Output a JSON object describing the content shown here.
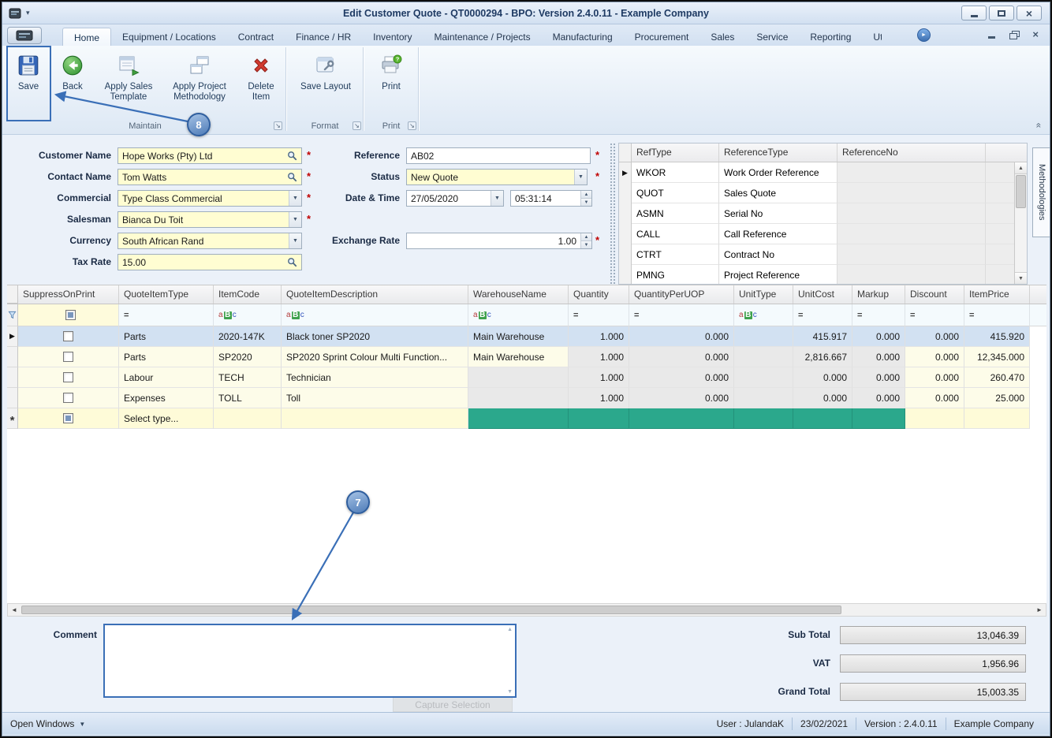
{
  "window": {
    "title": "Edit Customer Quote - QT0000294 - BPO: Version 2.4.0.11 - Example Company"
  },
  "icons": {
    "combo_arrow": "▼",
    "spin_up": "▲",
    "spin_down": "▼",
    "current_row": "▶",
    "new_row": "*",
    "scroll_left": "◄",
    "scroll_right": "►",
    "scroll_up": "▲",
    "scroll_down": "▼",
    "open_windows_caret": "▼",
    "ribbon_collapse": "«",
    "ribbon_scroll": "►",
    "dialog_launcher": "↘",
    "quick_access_caret": "▾"
  },
  "ribbon": {
    "tabs": [
      "Home",
      "Equipment / Locations",
      "Contract",
      "Finance / HR",
      "Inventory",
      "Maintenance / Projects",
      "Manufacturing",
      "Procurement",
      "Sales",
      "Service",
      "Reporting",
      "Utilities"
    ],
    "active_tab": "Home",
    "buttons": {
      "save": "Save",
      "back": "Back",
      "apply_sales_template": "Apply Sales Template",
      "apply_project_methodology": "Apply Project Methodology",
      "delete_item": "Delete Item",
      "save_layout": "Save Layout",
      "print": "Print"
    },
    "groups": {
      "maintain": "Maintain",
      "format": "Format",
      "print": "Print"
    }
  },
  "form": {
    "required_marker": "*",
    "customer_name": {
      "label": "Customer Name",
      "value": "Hope Works (Pty) Ltd"
    },
    "contact_name": {
      "label": "Contact Name",
      "value": "Tom Watts"
    },
    "commercial": {
      "label": "Commercial",
      "value": "Type Class Commercial"
    },
    "salesman": {
      "label": "Salesman",
      "value": "Bianca Du Toit"
    },
    "currency": {
      "label": "Currency",
      "value": "South African Rand"
    },
    "tax_rate": {
      "label": "Tax Rate",
      "value": "15.00"
    },
    "reference": {
      "label": "Reference",
      "value": "AB02"
    },
    "status": {
      "label": "Status",
      "value": "New Quote"
    },
    "date_time": {
      "label": "Date & Time",
      "date": "27/05/2020",
      "time": "05:31:14"
    },
    "exchange_rate": {
      "label": "Exchange Rate",
      "value": "1.00"
    }
  },
  "reference_table": {
    "columns": [
      "RefType",
      "ReferenceType",
      "ReferenceNo"
    ],
    "rows": [
      {
        "ref_type": "WKOR",
        "reference_type": "Work Order Reference",
        "reference_no": "",
        "current": true
      },
      {
        "ref_type": "QUOT",
        "reference_type": "Sales Quote",
        "reference_no": ""
      },
      {
        "ref_type": "ASMN",
        "reference_type": "Serial No",
        "reference_no": ""
      },
      {
        "ref_type": "CALL",
        "reference_type": "Call Reference",
        "reference_no": ""
      },
      {
        "ref_type": "CTRT",
        "reference_type": "Contract No",
        "reference_no": ""
      },
      {
        "ref_type": "PMNG",
        "reference_type": "Project Reference",
        "reference_no": ""
      }
    ]
  },
  "side_tab": {
    "label": "Methodologies"
  },
  "grid": {
    "columns": [
      "SuppressOnPrint",
      "QuoteItemType",
      "ItemCode",
      "QuoteItemDescription",
      "WarehouseName",
      "Quantity",
      "QuantityPerUOP",
      "UnitType",
      "UnitCost",
      "Markup",
      "Discount",
      "ItemPrice"
    ],
    "filter": {
      "numeric": "=",
      "text": [
        "a",
        "B",
        "c"
      ]
    },
    "rows": [
      {
        "suppress_on_print": false,
        "quote_item_type": "Parts",
        "item_code": "2020-147K",
        "quote_item_description": "Black toner SP2020",
        "warehouse_name": "Main Warehouse",
        "quantity": "1.000",
        "quantity_per_uop": "0.000",
        "unit_type": "",
        "unit_cost": "415.917",
        "markup": "0.000",
        "discount": "0.000",
        "item_price": "415.920"
      },
      {
        "suppress_on_print": false,
        "quote_item_type": "Parts",
        "item_code": "SP2020",
        "quote_item_description": "SP2020 Sprint Colour Multi Function...",
        "warehouse_name": "Main Warehouse",
        "quantity": "1.000",
        "quantity_per_uop": "0.000",
        "unit_type": "",
        "unit_cost": "2,816.667",
        "markup": "0.000",
        "discount": "0.000",
        "item_price": "12,345.000"
      },
      {
        "suppress_on_print": false,
        "quote_item_type": "Labour",
        "item_code": "TECH",
        "quote_item_description": "Technician",
        "warehouse_name": "",
        "quantity": "1.000",
        "quantity_per_uop": "0.000",
        "unit_type": "",
        "unit_cost": "0.000",
        "markup": "0.000",
        "discount": "0.000",
        "item_price": "260.470"
      },
      {
        "suppress_on_print": false,
        "quote_item_type": "Expenses",
        "item_code": "TOLL",
        "quote_item_description": "Toll",
        "warehouse_name": "",
        "quantity": "1.000",
        "quantity_per_uop": "0.000",
        "unit_type": "",
        "unit_cost": "0.000",
        "markup": "0.000",
        "discount": "0.000",
        "item_price": "25.000"
      }
    ],
    "new_row": {
      "quote_item_type": "Select type..."
    }
  },
  "comment": {
    "label": "Comment",
    "value": ""
  },
  "capture_button": {
    "label": "Capture Selection"
  },
  "totals": {
    "sub_total": {
      "label": "Sub Total",
      "value": "13,046.39"
    },
    "vat": {
      "label": "VAT",
      "value": "1,956.96"
    },
    "grand_total": {
      "label": "Grand Total",
      "value": "15,003.35"
    }
  },
  "status_bar": {
    "open_windows": "Open Windows",
    "user": "User : JulandaK",
    "date": "23/02/2021",
    "version": "Version : 2.4.0.11",
    "company": "Example Company"
  },
  "annotations": {
    "step_7": "7",
    "step_8": "8"
  },
  "colors": {
    "annotation_blue": "#3A6FB7",
    "new_row_teal": "#2BA88C",
    "required_red": "#C00000",
    "field_yellow": "#FFFDD2"
  }
}
